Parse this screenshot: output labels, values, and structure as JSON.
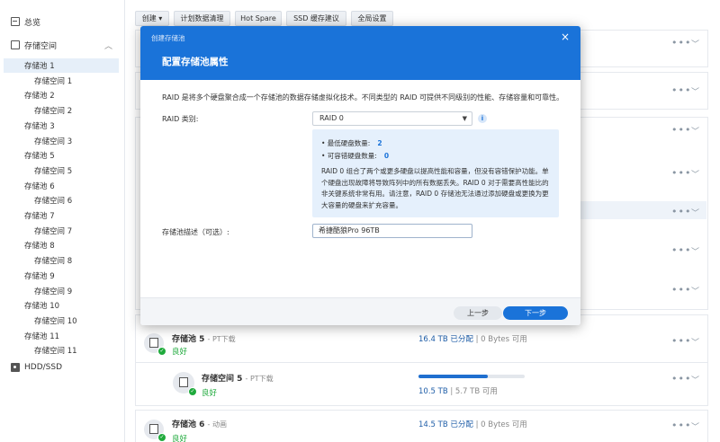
{
  "sidebar": {
    "overview": "总览",
    "storage": "存储空间",
    "items": [
      {
        "label": "存储池 1",
        "level": 1,
        "active": true
      },
      {
        "label": "存储空间 1",
        "level": 2
      },
      {
        "label": "存储池 2",
        "level": 1
      },
      {
        "label": "存储空间 2",
        "level": 2
      },
      {
        "label": "存储池 3",
        "level": 1
      },
      {
        "label": "存储空间 3",
        "level": 2
      },
      {
        "label": "存储池 5",
        "level": 1
      },
      {
        "label": "存储空间 5",
        "level": 2
      },
      {
        "label": "存储池 6",
        "level": 1
      },
      {
        "label": "存储空间 6",
        "level": 2
      },
      {
        "label": "存储池 7",
        "level": 1
      },
      {
        "label": "存储空间 7",
        "level": 2
      },
      {
        "label": "存储池 8",
        "level": 1
      },
      {
        "label": "存储空间 8",
        "level": 2
      },
      {
        "label": "存储池 9",
        "level": 1
      },
      {
        "label": "存储空间 9",
        "level": 2
      },
      {
        "label": "存储池 10",
        "level": 1
      },
      {
        "label": "存储空间 10",
        "level": 2
      },
      {
        "label": "存储池 11",
        "level": 1
      },
      {
        "label": "存储空间 11",
        "level": 2
      }
    ],
    "hdd": "HDD/SSD"
  },
  "toolbar": {
    "create": "创建 ▾",
    "scrub": "计划数据清理",
    "hotspare": "Hot Spare",
    "ssd_cache": "SSD 缓存建议",
    "global": "全局设置"
  },
  "background": {
    "pool5": {
      "name": "存储池 5",
      "sub": "- PT下载",
      "status": "良好",
      "allocated": "16.4 TB 已分配",
      "free": "| 0 Bytes 可用"
    },
    "vol5": {
      "name": "存储空间 5",
      "sub": "- PT下载",
      "status": "良好",
      "used": "10.5 TB",
      "total": "| 5.7 TB 可用",
      "usage_fraction": 0.65
    },
    "pool6": {
      "name": "存储池 6",
      "sub": "- 动画",
      "status": "良好",
      "allocated": "14.5 TB 已分配",
      "free": "| 0 Bytes 可用"
    }
  },
  "modal": {
    "small_title": "创建存储池",
    "close": "×",
    "title": "配置存储池属性",
    "description": "RAID 是将多个硬盘聚合成一个存储池的数据存储虚拟化技术。不同类型的 RAID 可提供不同级别的性能、存储容量和可靠性。",
    "raid_label": "RAID 类别:",
    "raid_value": "RAID 0",
    "info_icon": "i",
    "min_disks_label": "• 最低硬盘数量:",
    "min_disks_value": "2",
    "fault_tol_label": "• 可容错硬盘数量:",
    "fault_tol_value": "0",
    "raid_desc": "RAID 0 组合了两个或更多硬盘以提高性能和容量，但没有容错保护功能。单个硬盘出现故障将导致阵列中的所有数据丢失。RAID 0 对于需要高性能比的非关键系统非常有用。请注意，RAID 0 存储池无法通过添加硬盘或更换为更大容量的硬盘来扩充容量。",
    "pool_desc_label": "存储池描述（可选）:",
    "pool_desc_value": "希捷酷狼Pro 96TB",
    "prev": "上一步",
    "next": "下一步"
  },
  "colors": {
    "accent": "#1a73d9",
    "ok": "#1faa3c",
    "info_bg": "#e5f0fc"
  }
}
